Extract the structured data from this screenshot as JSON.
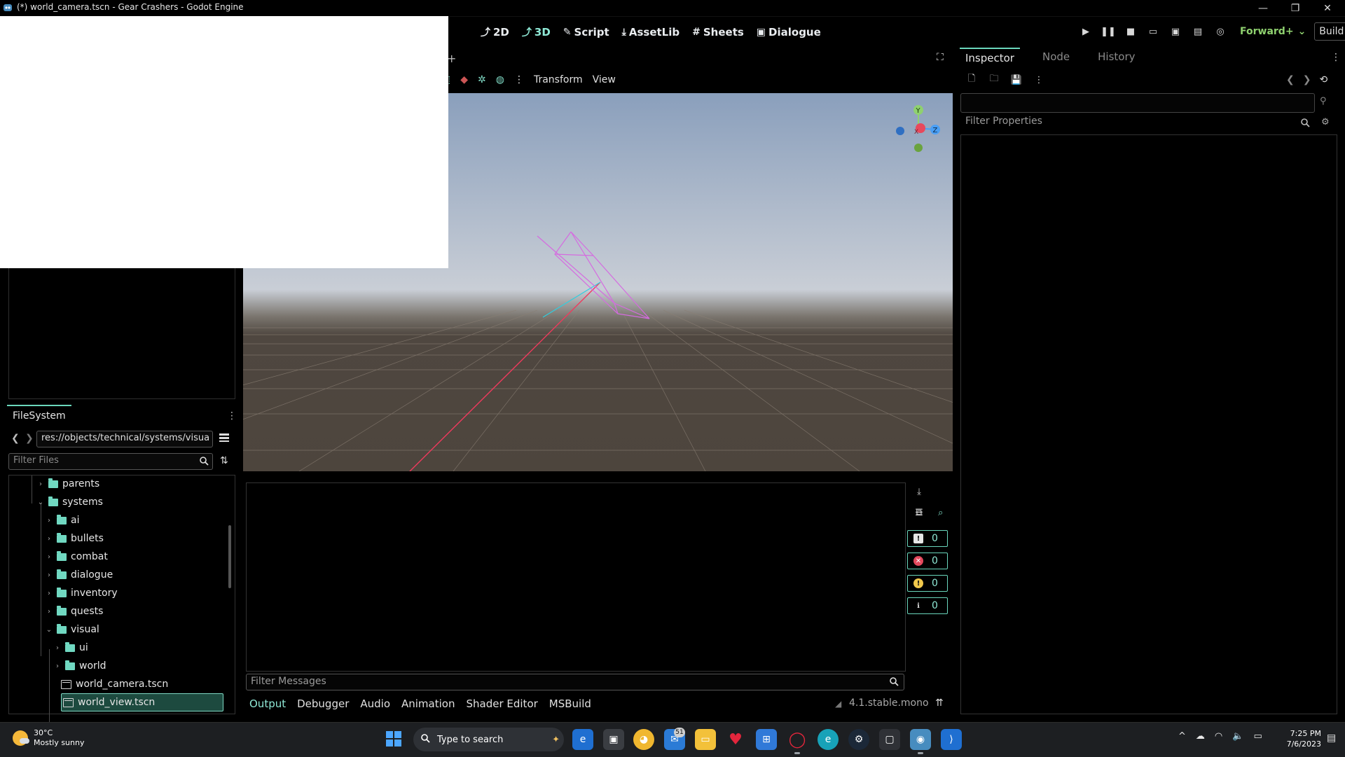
{
  "window": {
    "title": "(*) world_camera.tscn - Gear Crashers - Godot Engine",
    "minimize": "—",
    "maximize": "❐",
    "close": "✕"
  },
  "workspaces": [
    {
      "label": "2D",
      "glyph": "⤴",
      "active": false
    },
    {
      "label": "3D",
      "glyph": "⤴",
      "active": true
    },
    {
      "label": "Script",
      "glyph": "✎",
      "active": false
    },
    {
      "label": "AssetLib",
      "glyph": "⤓",
      "active": false
    },
    {
      "label": "Sheets",
      "glyph": "#",
      "active": false
    },
    {
      "label": "Dialogue",
      "glyph": "▣",
      "active": false
    }
  ],
  "run": {
    "renderer": "Forward+",
    "build": "Build"
  },
  "viewport": {
    "toolbar": {
      "transform": "Transform",
      "view": "View"
    },
    "gizmo": {
      "y": "Y",
      "z": "Z",
      "x": "X"
    },
    "colors": {
      "sky_top": "#8a9fbc",
      "sky_horizon": "#c9ced6",
      "ground": "#4d453d"
    }
  },
  "filesystem": {
    "tab": "FileSystem",
    "path": "res://objects/technical/systems/visua",
    "filter_placeholder": "Filter Files",
    "tree": [
      {
        "label": "parents",
        "type": "folder",
        "expanded": false,
        "depth": 0
      },
      {
        "label": "systems",
        "type": "folder",
        "expanded": true,
        "depth": 0
      },
      {
        "label": "ai",
        "type": "folder",
        "expanded": false,
        "depth": 1
      },
      {
        "label": "bullets",
        "type": "folder",
        "expanded": false,
        "depth": 1
      },
      {
        "label": "combat",
        "type": "folder",
        "expanded": false,
        "depth": 1
      },
      {
        "label": "dialogue",
        "type": "folder",
        "expanded": false,
        "depth": 1
      },
      {
        "label": "inventory",
        "type": "folder",
        "expanded": false,
        "depth": 1
      },
      {
        "label": "quests",
        "type": "folder",
        "expanded": false,
        "depth": 1
      },
      {
        "label": "visual",
        "type": "folder",
        "expanded": true,
        "depth": 1
      },
      {
        "label": "ui",
        "type": "folder",
        "expanded": false,
        "depth": 2
      },
      {
        "label": "world",
        "type": "folder",
        "expanded": false,
        "depth": 2
      },
      {
        "label": "world_camera.tscn",
        "type": "scene",
        "depth": 2
      },
      {
        "label": "world_view.tscn",
        "type": "scene",
        "depth": 2,
        "selected": true
      }
    ]
  },
  "output": {
    "filter_placeholder": "Filter Messages",
    "counters": [
      "0",
      "0",
      "0",
      "0"
    ],
    "tabs": [
      "Output",
      "Debugger",
      "Audio",
      "Animation",
      "Shader Editor",
      "MSBuild"
    ],
    "version": "4.1.stable.mono"
  },
  "inspector": {
    "tabs": [
      "Inspector",
      "Node",
      "History"
    ],
    "filter_placeholder": "Filter Properties"
  },
  "taskbar": {
    "weather_temp": "30°C",
    "weather_desc": "Mostly sunny",
    "search_placeholder": "Type to search",
    "mail_badge": "51",
    "time": "7:25 PM",
    "date": "7/6/2023"
  }
}
